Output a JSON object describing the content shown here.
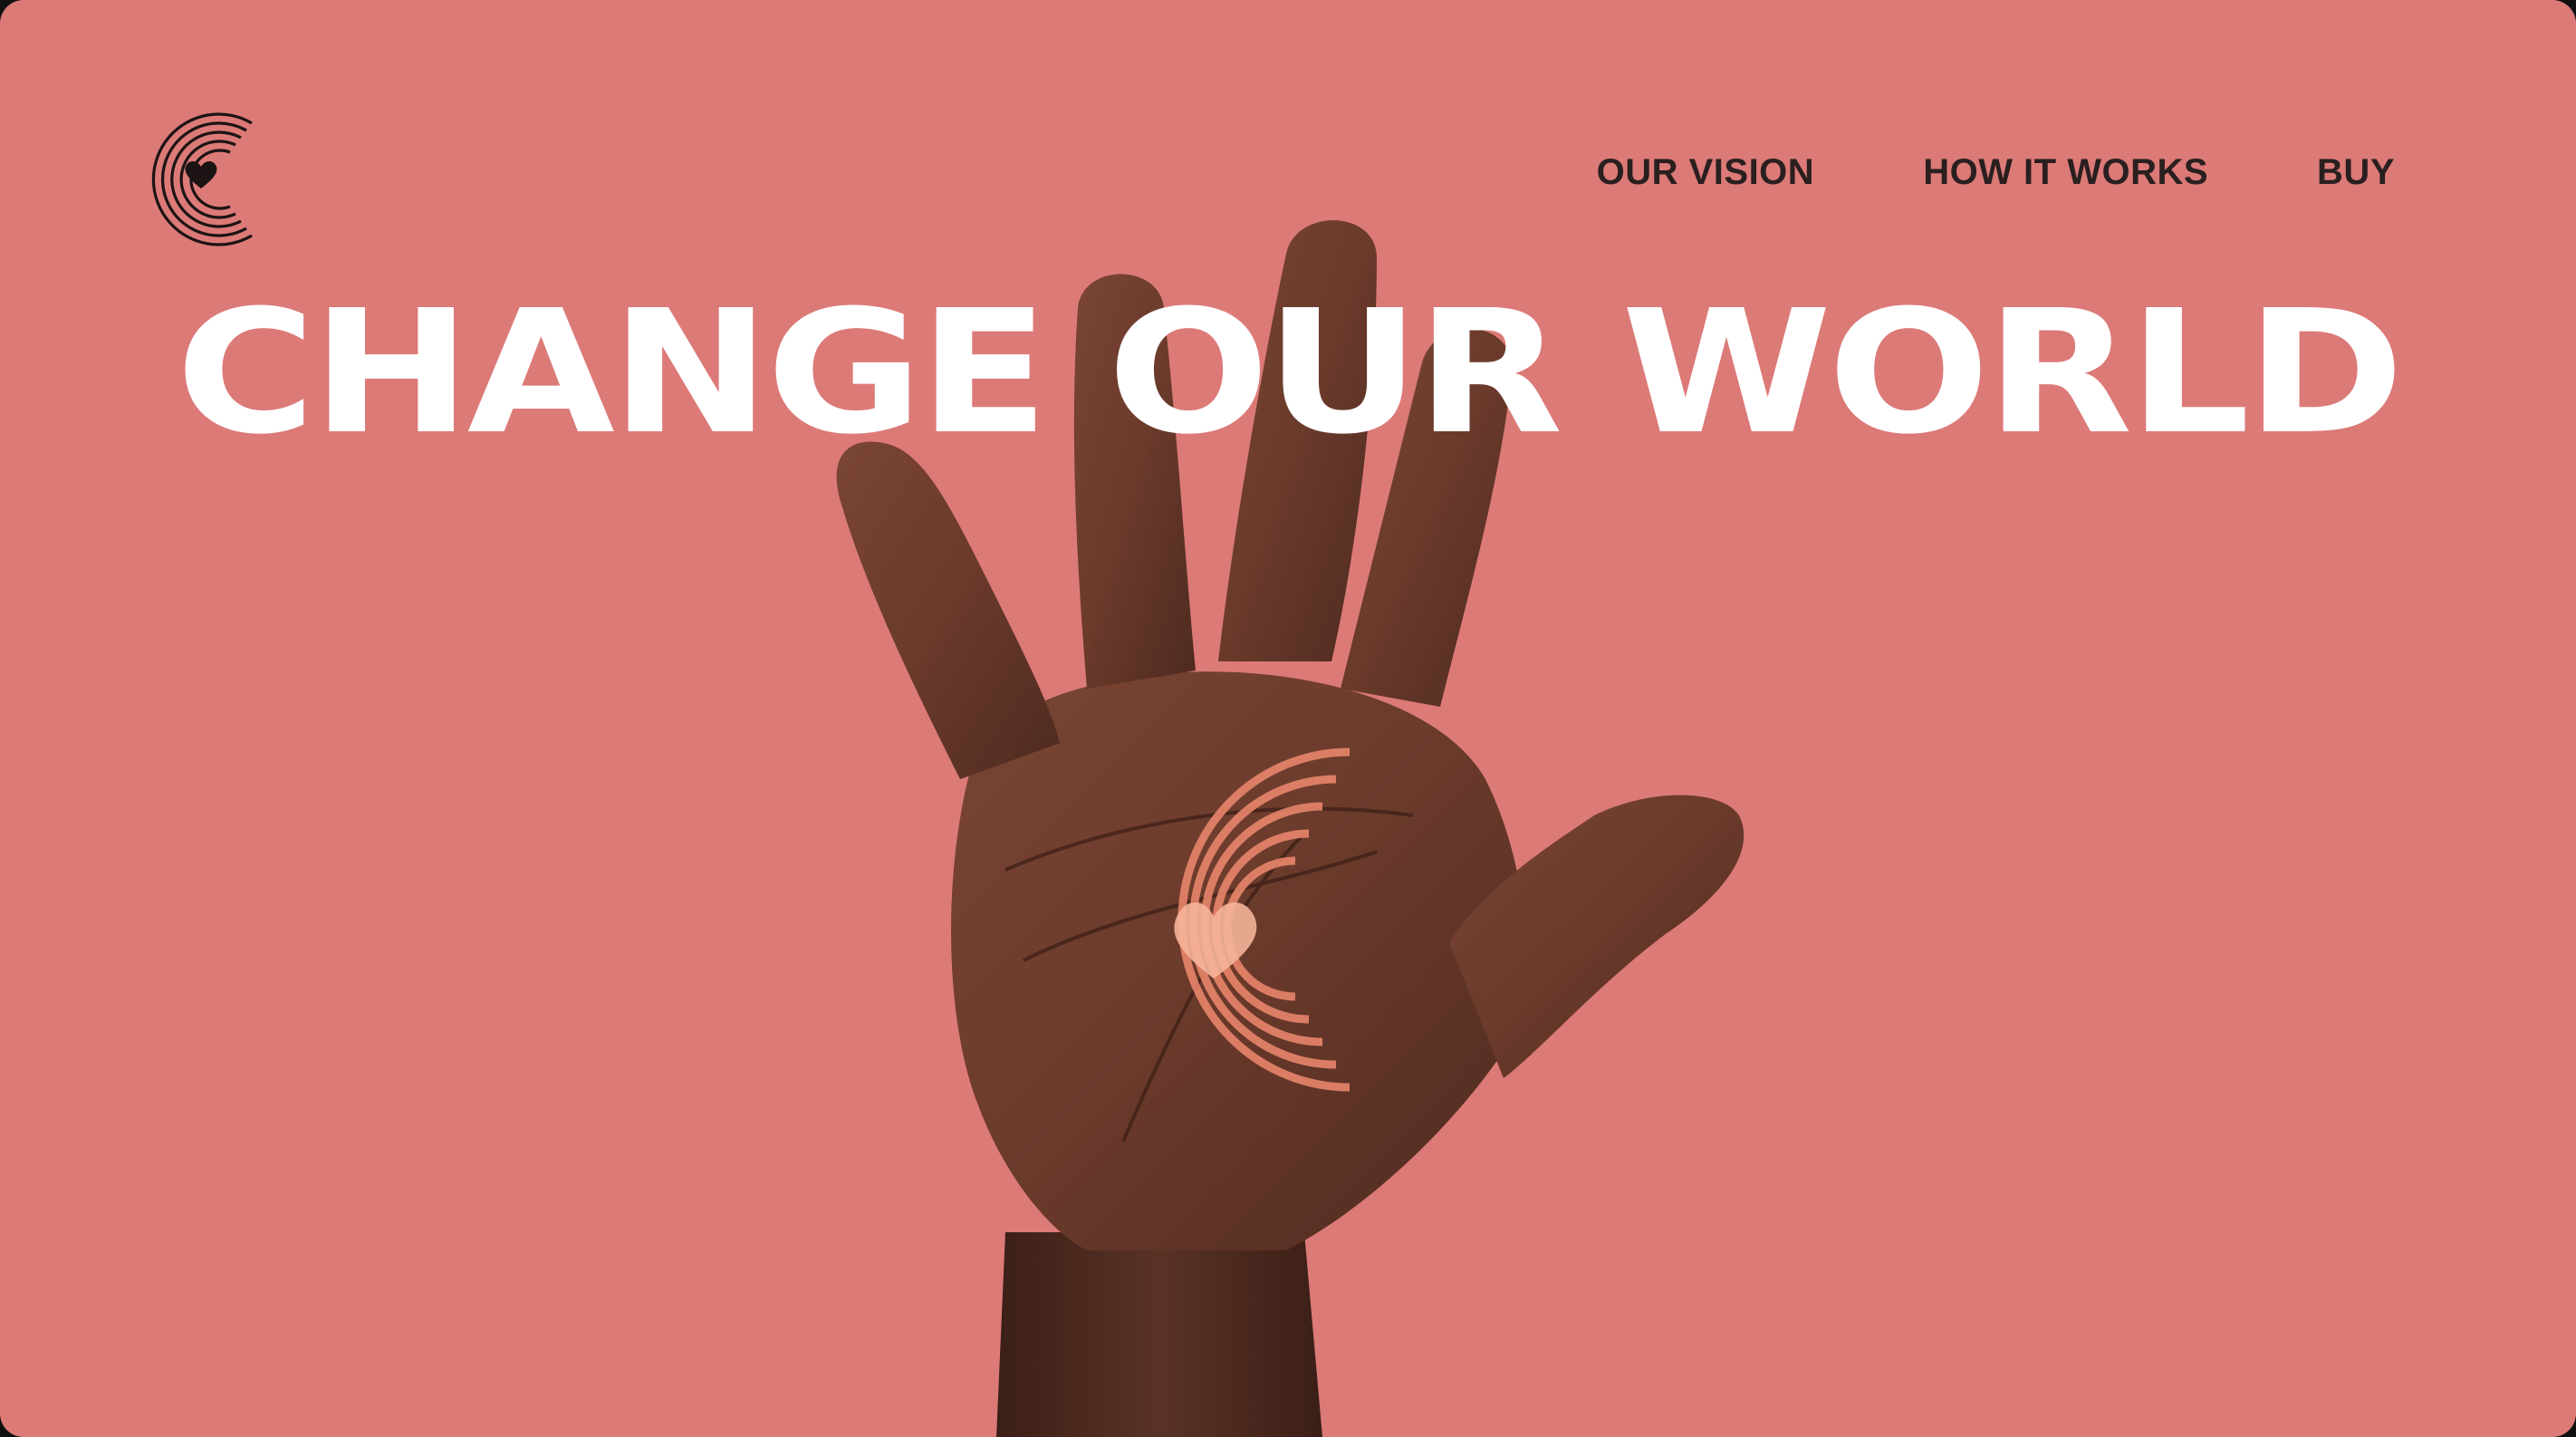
{
  "brand": {
    "logo_icon": "heart-rings-logo-icon"
  },
  "nav": {
    "items": [
      {
        "label": "OUR VISION"
      },
      {
        "label": "HOW IT WORKS"
      },
      {
        "label": "BUY"
      }
    ]
  },
  "hero": {
    "headline": "CHANGE OUR WORLD",
    "image": "raised-hand-with-heart-logo-on-palm"
  },
  "colors": {
    "background": "#dc7a78",
    "headline": "#ffffff",
    "nav_text": "#2a1f1f",
    "skin": "#6b3b2c"
  }
}
